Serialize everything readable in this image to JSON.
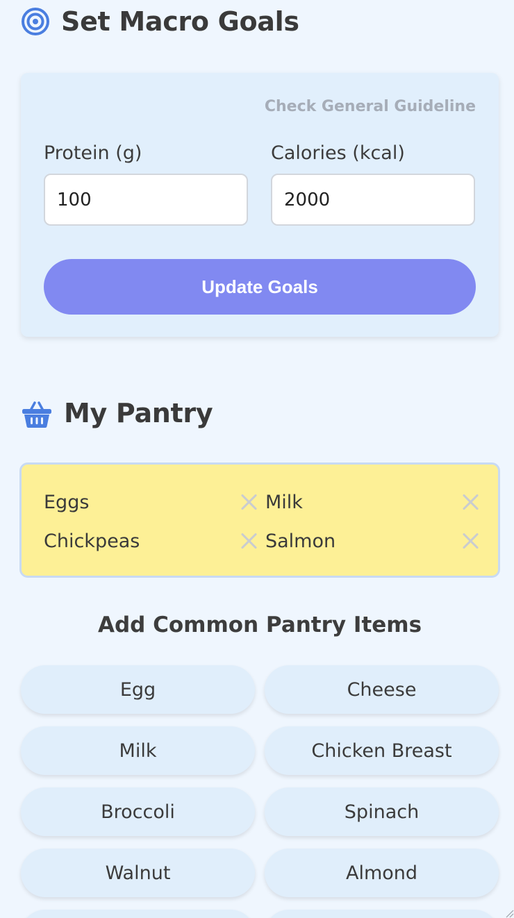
{
  "goals": {
    "title": "Set Macro Goals",
    "icon": "target-icon",
    "guideline_link": "Check General Guideline",
    "protein_label": "Protein (g)",
    "protein_value": "100",
    "calories_label": "Calories (kcal)",
    "calories_value": "2000",
    "update_button": "Update Goals"
  },
  "pantry": {
    "title": "My Pantry",
    "icon": "basket-icon",
    "items": [
      {
        "name": "Eggs"
      },
      {
        "name": "Milk"
      },
      {
        "name": "Chickpeas"
      },
      {
        "name": "Salmon"
      }
    ]
  },
  "common": {
    "title": "Add Common Pantry Items",
    "items": [
      "Egg",
      "Cheese",
      "Milk",
      "Chicken Breast",
      "Broccoli",
      "Spinach",
      "Walnut",
      "Almond"
    ]
  },
  "colors": {
    "accent": "#8189f1",
    "icon_blue": "#4a7ee0",
    "pantry_bg": "#fdf096",
    "page_bg": "#eff6fe"
  }
}
